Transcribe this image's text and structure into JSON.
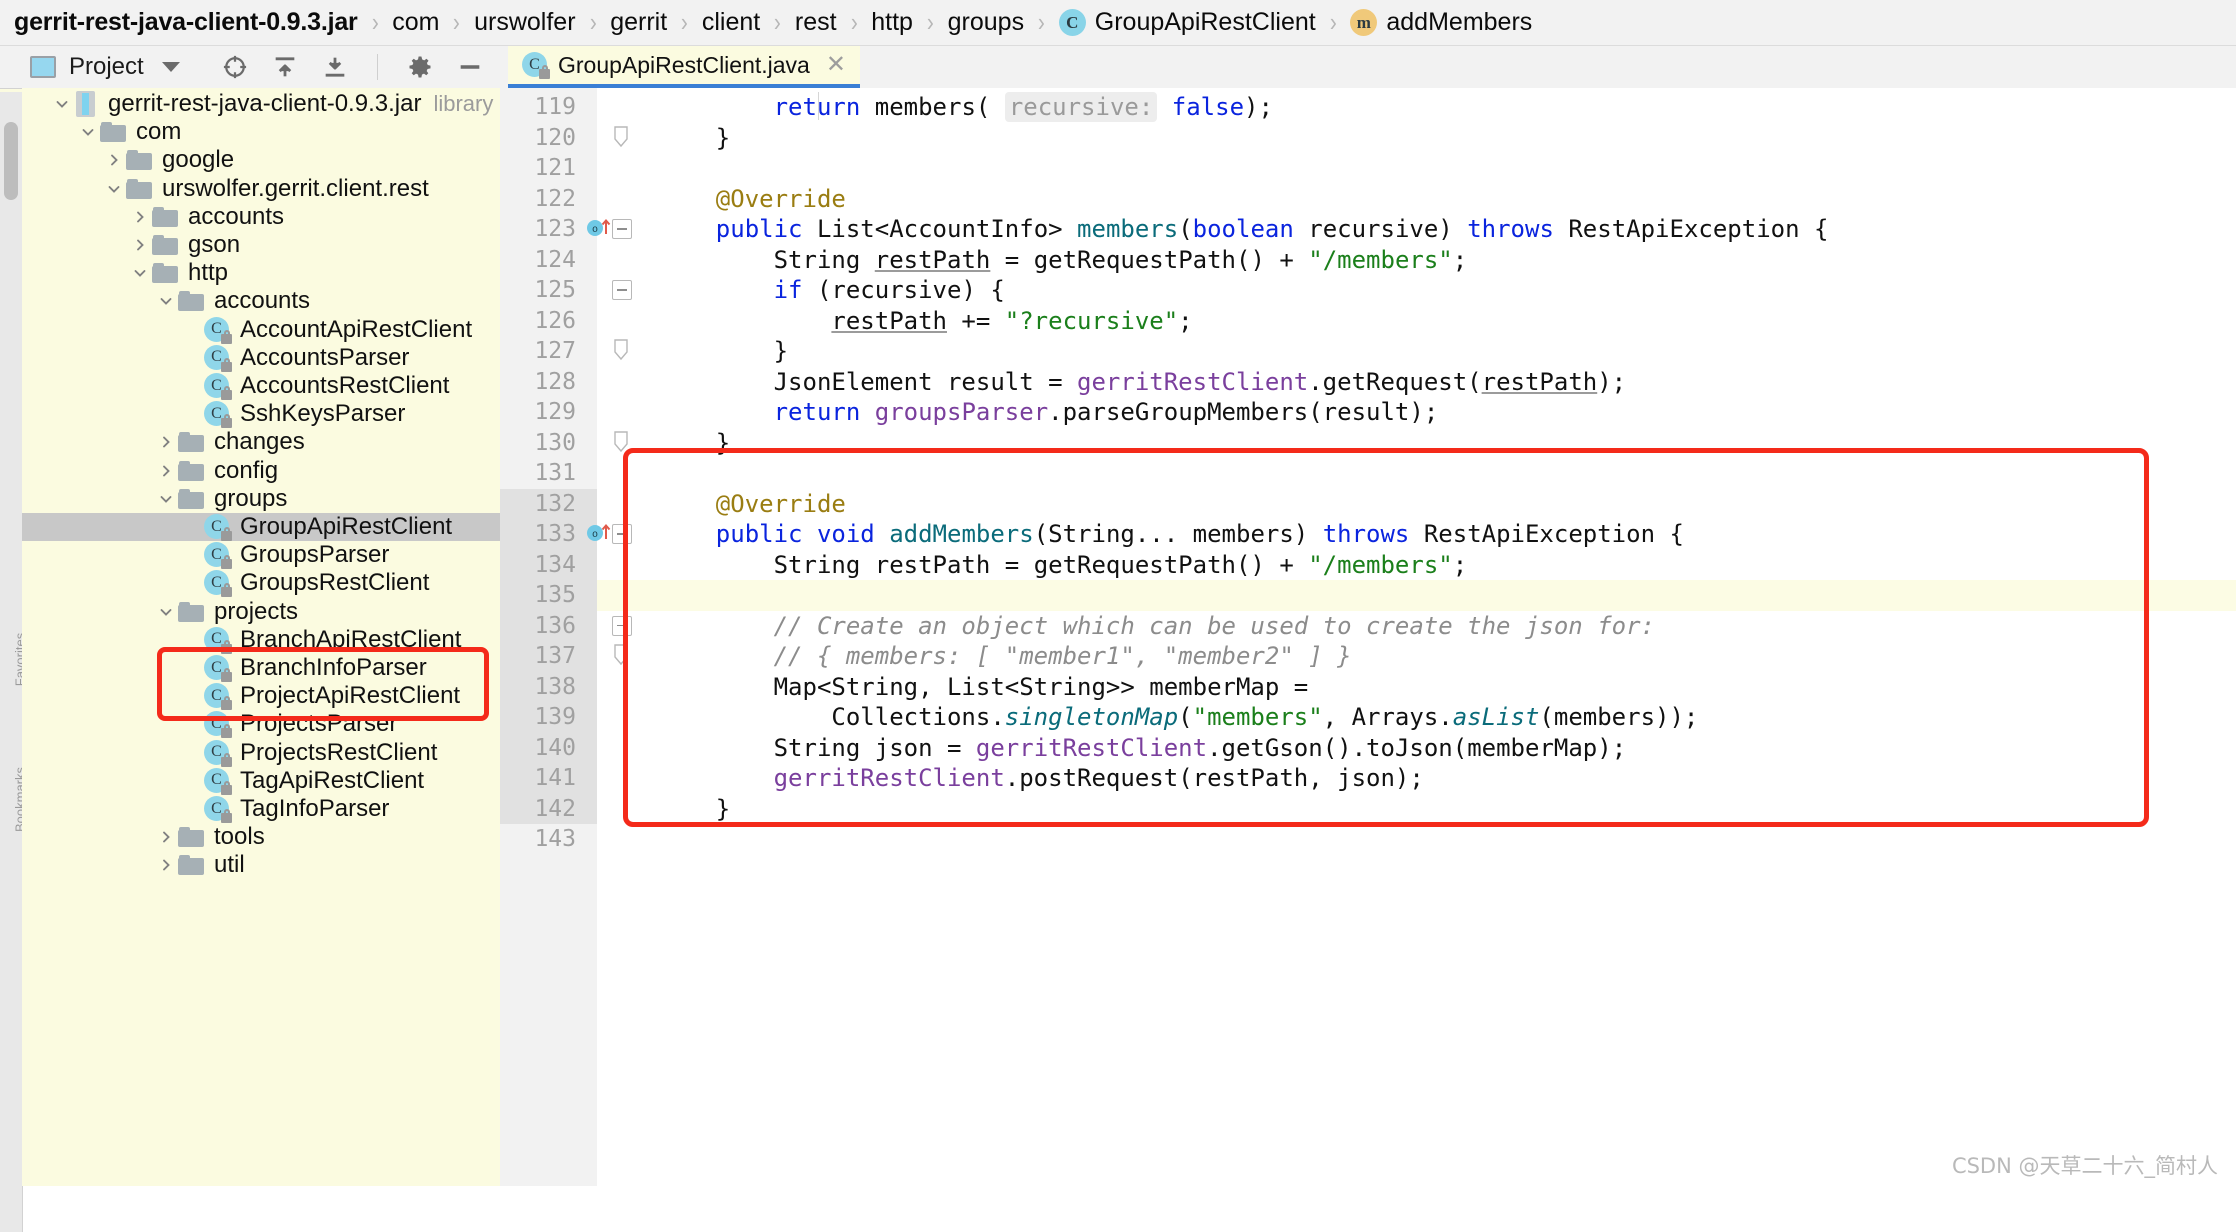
{
  "breadcrumb": {
    "separator": "›",
    "items": [
      {
        "label": "gerrit-rest-java-client-0.9.3.jar",
        "icon": "none",
        "bold": true
      },
      {
        "label": "com",
        "icon": "none",
        "bold": false
      },
      {
        "label": "urswolfer",
        "icon": "none",
        "bold": false
      },
      {
        "label": "gerrit",
        "icon": "none",
        "bold": false
      },
      {
        "label": "client",
        "icon": "none",
        "bold": false
      },
      {
        "label": "rest",
        "icon": "none",
        "bold": false
      },
      {
        "label": "http",
        "icon": "none",
        "bold": false
      },
      {
        "label": "groups",
        "icon": "none",
        "bold": false
      },
      {
        "label": "GroupApiRestClient",
        "icon": "class-icon",
        "icon_letter": "C",
        "bold": false
      },
      {
        "label": "addMembers",
        "icon": "method-icon",
        "icon_letter": "m",
        "bold": false
      }
    ]
  },
  "tool_window": {
    "title": "Project",
    "title_icon": "project-icon",
    "dropdown_icon": "chevron-down-icon",
    "toolbar": [
      {
        "name": "locate-icon",
        "tooltip": "Select Opened File"
      },
      {
        "name": "expand-all-icon",
        "tooltip": "Expand All"
      },
      {
        "name": "collapse-all-icon",
        "tooltip": "Collapse All"
      },
      {
        "name": "gear-icon",
        "tooltip": "Settings"
      },
      {
        "name": "hide-icon",
        "tooltip": "Hide"
      }
    ],
    "side_labels": [
      "Favorites",
      "Bookmarks"
    ]
  },
  "tree": {
    "selected_node": "GroupApiRestClient",
    "nodes": [
      {
        "label": "gerrit-rest-java-client-0.9.3.jar",
        "suffix": "library root",
        "depth": 1,
        "twisty": "open",
        "icon": "jar-icon"
      },
      {
        "label": "com",
        "depth": 2,
        "twisty": "open",
        "icon": "folder-icon"
      },
      {
        "label": "google",
        "depth": 3,
        "twisty": "closed",
        "icon": "folder-icon"
      },
      {
        "label": "urswolfer.gerrit.client.rest",
        "depth": 3,
        "twisty": "open",
        "icon": "folder-icon"
      },
      {
        "label": "accounts",
        "depth": 4,
        "twisty": "closed",
        "icon": "folder-icon"
      },
      {
        "label": "gson",
        "depth": 4,
        "twisty": "closed",
        "icon": "folder-icon"
      },
      {
        "label": "http",
        "depth": 4,
        "twisty": "open",
        "icon": "folder-icon"
      },
      {
        "label": "accounts",
        "depth": 5,
        "twisty": "open",
        "icon": "folder-icon"
      },
      {
        "label": "AccountApiRestClient",
        "depth": 6,
        "twisty": "none",
        "icon": "class-icon"
      },
      {
        "label": "AccountsParser",
        "depth": 6,
        "twisty": "none",
        "icon": "class-icon"
      },
      {
        "label": "AccountsRestClient",
        "depth": 6,
        "twisty": "none",
        "icon": "class-icon"
      },
      {
        "label": "SshKeysParser",
        "depth": 6,
        "twisty": "none",
        "icon": "class-icon"
      },
      {
        "label": "changes",
        "depth": 5,
        "twisty": "closed",
        "icon": "folder-icon"
      },
      {
        "label": "config",
        "depth": 5,
        "twisty": "closed",
        "icon": "folder-icon"
      },
      {
        "label": "groups",
        "depth": 5,
        "twisty": "open",
        "icon": "folder-icon"
      },
      {
        "label": "GroupApiRestClient",
        "depth": 6,
        "twisty": "none",
        "icon": "class-icon",
        "selected": true
      },
      {
        "label": "GroupsParser",
        "depth": 6,
        "twisty": "none",
        "icon": "class-icon"
      },
      {
        "label": "GroupsRestClient",
        "depth": 6,
        "twisty": "none",
        "icon": "class-icon"
      },
      {
        "label": "projects",
        "depth": 5,
        "twisty": "open",
        "icon": "folder-icon"
      },
      {
        "label": "BranchApiRestClient",
        "depth": 6,
        "twisty": "none",
        "icon": "class-icon"
      },
      {
        "label": "BranchInfoParser",
        "depth": 6,
        "twisty": "none",
        "icon": "class-icon"
      },
      {
        "label": "ProjectApiRestClient",
        "depth": 6,
        "twisty": "none",
        "icon": "class-icon"
      },
      {
        "label": "ProjectsParser",
        "depth": 6,
        "twisty": "none",
        "icon": "class-icon"
      },
      {
        "label": "ProjectsRestClient",
        "depth": 6,
        "twisty": "none",
        "icon": "class-icon"
      },
      {
        "label": "TagApiRestClient",
        "depth": 6,
        "twisty": "none",
        "icon": "class-icon"
      },
      {
        "label": "TagInfoParser",
        "depth": 6,
        "twisty": "none",
        "icon": "class-icon"
      },
      {
        "label": "tools",
        "depth": 5,
        "twisty": "closed",
        "icon": "folder-icon"
      },
      {
        "label": "util",
        "depth": 5,
        "twisty": "closed",
        "icon": "folder-icon"
      }
    ]
  },
  "editor": {
    "tab": {
      "label": "GroupApiRestClient.java",
      "icon": "class-icon",
      "close_icon": "close-icon",
      "active": true
    },
    "first_line_number": 119,
    "last_line_number": 143,
    "lines": [
      {
        "n": 119,
        "text": "        return members( recursive: false);"
      },
      {
        "n": 120,
        "text": "    }",
        "fold": "end"
      },
      {
        "n": 121,
        "text": ""
      },
      {
        "n": 122,
        "text": "    @Override"
      },
      {
        "n": 123,
        "text": "    public List<AccountInfo> members(boolean recursive) throws RestApiException {",
        "gutter_mark": "override-marker",
        "fold": "start"
      },
      {
        "n": 124,
        "text": "        String restPath = getRequestPath() + \"/members\";"
      },
      {
        "n": 125,
        "text": "        if (recursive) {",
        "fold": "start"
      },
      {
        "n": 126,
        "text": "            restPath += \"?recursive\";"
      },
      {
        "n": 127,
        "text": "        }",
        "fold": "end"
      },
      {
        "n": 128,
        "text": "        JsonElement result = gerritRestClient.getRequest(restPath);"
      },
      {
        "n": 129,
        "text": "        return groupsParser.parseGroupMembers(result);"
      },
      {
        "n": 130,
        "text": "    }",
        "fold": "end"
      },
      {
        "n": 131,
        "text": ""
      },
      {
        "n": 132,
        "text": "    @Override"
      },
      {
        "n": 133,
        "text": "    public void addMembers(String... members) throws RestApiException {",
        "gutter_mark": "override-marker",
        "fold": "start"
      },
      {
        "n": 134,
        "text": "        String restPath = getRequestPath() + \"/members\";"
      },
      {
        "n": 135,
        "text": "",
        "caret": true
      },
      {
        "n": 136,
        "text": "        // Create an object which can be used to create the json for:",
        "fold": "start"
      },
      {
        "n": 137,
        "text": "        // { members: [ \"member1\", \"member2\" ] }",
        "fold": "end"
      },
      {
        "n": 138,
        "text": "        Map<String, List<String>> memberMap ="
      },
      {
        "n": 139,
        "text": "            Collections.singletonMap(\"members\", Arrays.asList(members));"
      },
      {
        "n": 140,
        "text": "        String json = gerritRestClient.getGson().toJson(memberMap);"
      },
      {
        "n": 141,
        "text": "        gerritRestClient.postRequest(restPath, json);"
      },
      {
        "n": 142,
        "text": "    }"
      },
      {
        "n": 143,
        "text": ""
      }
    ]
  },
  "annotations": {
    "highlight_color": "#f42a1a",
    "tree_box_label": "groups-package-highlight",
    "code_box_label": "addMembers-method-highlight"
  },
  "watermark": {
    "text": "CSDN @天草二十六_简村人"
  },
  "colors": {
    "tree_background": "#fbfbe0",
    "editor_background": "#ffffff",
    "chrome": "#f2f2f2",
    "selection": "#c8c8c8",
    "tab_underline": "#3a7fd5",
    "keyword": "#0a24de",
    "annotation": "#9a7d12",
    "string": "#1b7f1b",
    "field": "#7a3f9d",
    "method": "#0a6b7a",
    "comment": "#8c8c8c",
    "class_icon": "#8fd6e9",
    "method_icon": "#f0c97a"
  }
}
